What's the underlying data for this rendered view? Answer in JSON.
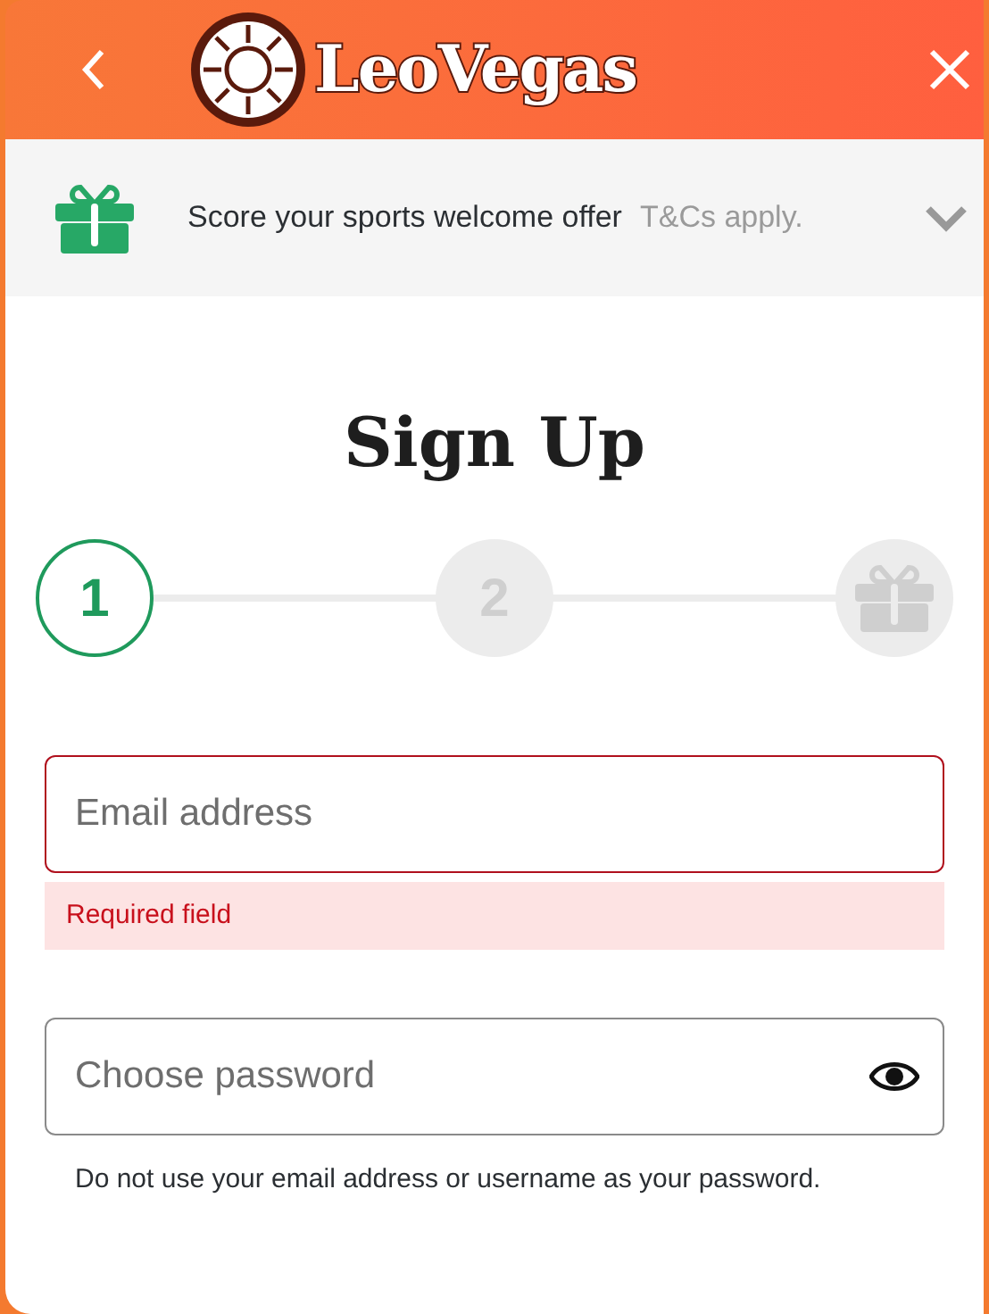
{
  "header": {
    "brand": "LeoVegas"
  },
  "offer": {
    "text": "Score your sports welcome offer",
    "terms": "T&Cs apply."
  },
  "title": "Sign Up",
  "steps": [
    {
      "kind": "number",
      "label": "1",
      "selected": true
    },
    {
      "kind": "number",
      "label": "2",
      "selected": false
    },
    {
      "kind": "gift",
      "selected": false
    }
  ],
  "fields": [
    {
      "kind": "email",
      "placeholder": "Email address",
      "error": "Required field"
    },
    {
      "kind": "password",
      "placeholder": "Choose password",
      "hint": "Do not use your email address or username as your password."
    }
  ]
}
